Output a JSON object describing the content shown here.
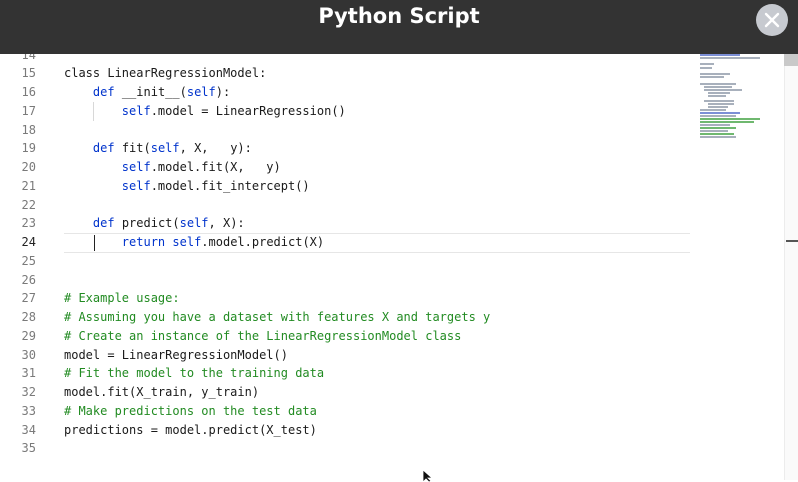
{
  "window": {
    "title": "Python Script",
    "close_icon": "close-icon"
  },
  "editor": {
    "active_line": 24,
    "lines": [
      {
        "num": "14",
        "tokens": [
          {
            "t": "",
            "c": "n"
          }
        ]
      },
      {
        "num": "15",
        "tokens": [
          {
            "t": "class LinearRegressionModel:",
            "c": "n"
          }
        ]
      },
      {
        "num": "16",
        "tokens": [
          {
            "t": "    ",
            "c": "n"
          },
          {
            "t": "def",
            "c": "k"
          },
          {
            "t": " __init__(",
            "c": "n"
          },
          {
            "t": "self",
            "c": "k"
          },
          {
            "t": "):",
            "c": "n"
          }
        ]
      },
      {
        "num": "17",
        "tokens": [
          {
            "t": "        ",
            "c": "n"
          },
          {
            "t": "self",
            "c": "k"
          },
          {
            "t": ".model = LinearRegression()",
            "c": "n"
          }
        ]
      },
      {
        "num": "18",
        "tokens": [
          {
            "t": "",
            "c": "n"
          }
        ]
      },
      {
        "num": "19",
        "tokens": [
          {
            "t": "    ",
            "c": "n"
          },
          {
            "t": "def",
            "c": "k"
          },
          {
            "t": " fit(",
            "c": "n"
          },
          {
            "t": "self",
            "c": "k"
          },
          {
            "t": ", X,   y):",
            "c": "n"
          }
        ]
      },
      {
        "num": "20",
        "tokens": [
          {
            "t": "        ",
            "c": "n"
          },
          {
            "t": "self",
            "c": "k"
          },
          {
            "t": ".model.fit(X,   y)",
            "c": "n"
          }
        ]
      },
      {
        "num": "21",
        "tokens": [
          {
            "t": "        ",
            "c": "n"
          },
          {
            "t": "self",
            "c": "k"
          },
          {
            "t": ".model.fit_intercept()",
            "c": "n"
          }
        ]
      },
      {
        "num": "22",
        "tokens": [
          {
            "t": "",
            "c": "n"
          }
        ]
      },
      {
        "num": "23",
        "tokens": [
          {
            "t": "    ",
            "c": "n"
          },
          {
            "t": "def",
            "c": "k"
          },
          {
            "t": " predict(",
            "c": "n"
          },
          {
            "t": "self",
            "c": "k"
          },
          {
            "t": ", X):",
            "c": "n"
          }
        ]
      },
      {
        "num": "24",
        "tokens": [
          {
            "t": "        ",
            "c": "n"
          },
          {
            "t": "return",
            "c": "k"
          },
          {
            "t": " ",
            "c": "n"
          },
          {
            "t": "self",
            "c": "k"
          },
          {
            "t": ".model.predict(X)",
            "c": "n"
          }
        ]
      },
      {
        "num": "25",
        "tokens": [
          {
            "t": "",
            "c": "n"
          }
        ]
      },
      {
        "num": "26",
        "tokens": [
          {
            "t": "",
            "c": "n"
          }
        ]
      },
      {
        "num": "27",
        "tokens": [
          {
            "t": "# Example usage:",
            "c": "c"
          }
        ]
      },
      {
        "num": "28",
        "tokens": [
          {
            "t": "# Assuming you have a dataset with features X and targets y",
            "c": "c"
          }
        ]
      },
      {
        "num": "29",
        "tokens": [
          {
            "t": "# Create an instance of the LinearRegressionModel class",
            "c": "c"
          }
        ]
      },
      {
        "num": "30",
        "tokens": [
          {
            "t": "model = LinearRegressionModel()",
            "c": "n"
          }
        ]
      },
      {
        "num": "31",
        "tokens": [
          {
            "t": "# Fit the model to the training data",
            "c": "c"
          }
        ]
      },
      {
        "num": "32",
        "tokens": [
          {
            "t": "model.fit(X_train, y_train)",
            "c": "n"
          }
        ]
      },
      {
        "num": "33",
        "tokens": [
          {
            "t": "# Make predictions on the test data",
            "c": "c"
          }
        ]
      },
      {
        "num": "34",
        "tokens": [
          {
            "t": "predictions = model.predict(X_test)",
            "c": "n"
          }
        ]
      },
      {
        "num": "35",
        "tokens": [
          {
            "t": "",
            "c": "n"
          }
        ]
      }
    ]
  },
  "colors": {
    "title_bar": "#333333",
    "keyword": "#0033cc",
    "comment": "#228b22",
    "text": "#1a1a1a"
  }
}
